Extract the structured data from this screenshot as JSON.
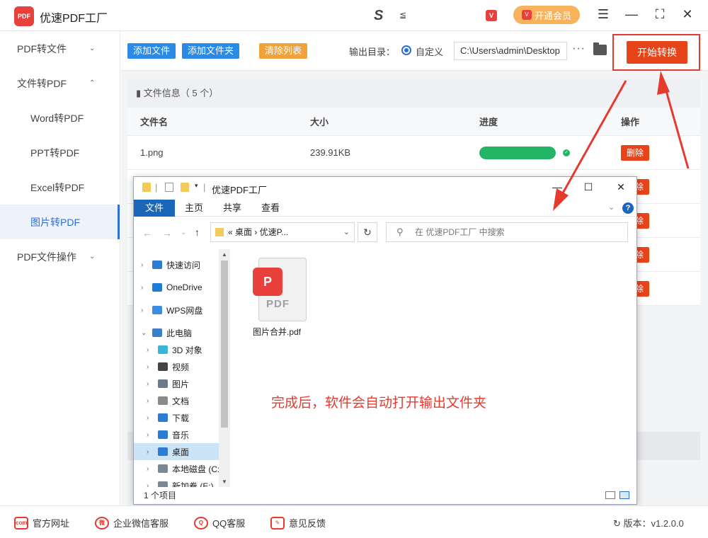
{
  "app": {
    "logo_text": "PDF",
    "title": "优速PDF工厂",
    "center_logo": "S",
    "center_logo_small": "≦",
    "vip_badge": "V",
    "member_button": "开通会员",
    "window_controls": {
      "menu": "☰",
      "minimize": "—",
      "maximize": "⛶",
      "close": "✕"
    }
  },
  "sidebar": {
    "items": [
      {
        "label": "PDF转文件",
        "chevron": "⌄"
      },
      {
        "label": "文件转PDF",
        "chevron": "⌃"
      },
      {
        "label": "Word转PDF"
      },
      {
        "label": "PPT转PDF"
      },
      {
        "label": "Excel转PDF"
      },
      {
        "label": "图片转PDF"
      },
      {
        "label": "PDF文件操作",
        "chevron": "⌄"
      }
    ],
    "active_index": 5
  },
  "toolbar": {
    "add_file": "添加文件",
    "add_folder": "添加文件夹",
    "clear_list": "清除列表",
    "output_label": "输出目录：",
    "radio_label": "自定义",
    "output_path": "C:\\Users\\admin\\Desktop",
    "more": "···",
    "start_button": "开始转换"
  },
  "file_panel": {
    "info": "文件信息（ 5 个）",
    "headers": {
      "name": "文件名",
      "size": "大小",
      "progress": "进度",
      "action": "操作"
    },
    "rows": [
      {
        "name": "1.png",
        "size": "239.91KB",
        "progress": 100,
        "action": "删除"
      },
      {
        "action": "删除"
      },
      {
        "action": "删除"
      },
      {
        "action": "删除"
      },
      {
        "action": "删除"
      }
    ]
  },
  "explorer": {
    "title": "优速PDF工厂",
    "ribbon_tabs": [
      "文件",
      "主页",
      "共享",
      "查看"
    ],
    "help": "?",
    "address": "« 桌面 › 优速P...",
    "search_placeholder": "在 优速PDF工厂 中搜索",
    "tree": [
      {
        "label": "快速访问",
        "level": 0,
        "icon_color": "#2b7cd3"
      },
      {
        "label": "OneDrive",
        "level": 0,
        "icon_color": "#1e7bd8"
      },
      {
        "label": "WPS网盘",
        "level": 0,
        "icon_color": "#3a8de0"
      },
      {
        "label": "此电脑",
        "level": 0,
        "icon_color": "#3b7fc9",
        "expanded": true
      },
      {
        "label": "3D 对象",
        "level": 1,
        "icon_color": "#39b5d8"
      },
      {
        "label": "视频",
        "level": 1,
        "icon_color": "#444444"
      },
      {
        "label": "图片",
        "level": 1,
        "icon_color": "#6a7c8c"
      },
      {
        "label": "文档",
        "level": 1,
        "icon_color": "#8a8a8a"
      },
      {
        "label": "下载",
        "level": 1,
        "icon_color": "#2b7cd3"
      },
      {
        "label": "音乐",
        "level": 1,
        "icon_color": "#2b7cd3"
      },
      {
        "label": "桌面",
        "level": 1,
        "icon_color": "#2b7cd3",
        "selected": true
      },
      {
        "label": "本地磁盘 (C:",
        "level": 1,
        "icon_color": "#7a8894"
      },
      {
        "label": "新加卷 (E:)",
        "level": 1,
        "icon_color": "#7a8894"
      }
    ],
    "file": {
      "badge": "P",
      "doc_text": "PDF",
      "name": "图片合并.pdf"
    },
    "note": "完成后，软件会自动打开输出文件夹",
    "status": "1 个项目"
  },
  "footer": {
    "links": [
      {
        "label": "官方网址",
        "icon": "com"
      },
      {
        "label": "企业微信客服",
        "icon": "微"
      },
      {
        "label": "QQ客服",
        "icon": "Q"
      },
      {
        "label": "意见反馈",
        "icon": "✎"
      }
    ],
    "version": "版本：v1.2.0.0"
  },
  "colors": {
    "accent_red": "#e8441a",
    "primary_blue": "#2b8ae6",
    "orange": "#f2a23a",
    "success_green": "#22b566",
    "annotation_red": "#e63a2e"
  }
}
